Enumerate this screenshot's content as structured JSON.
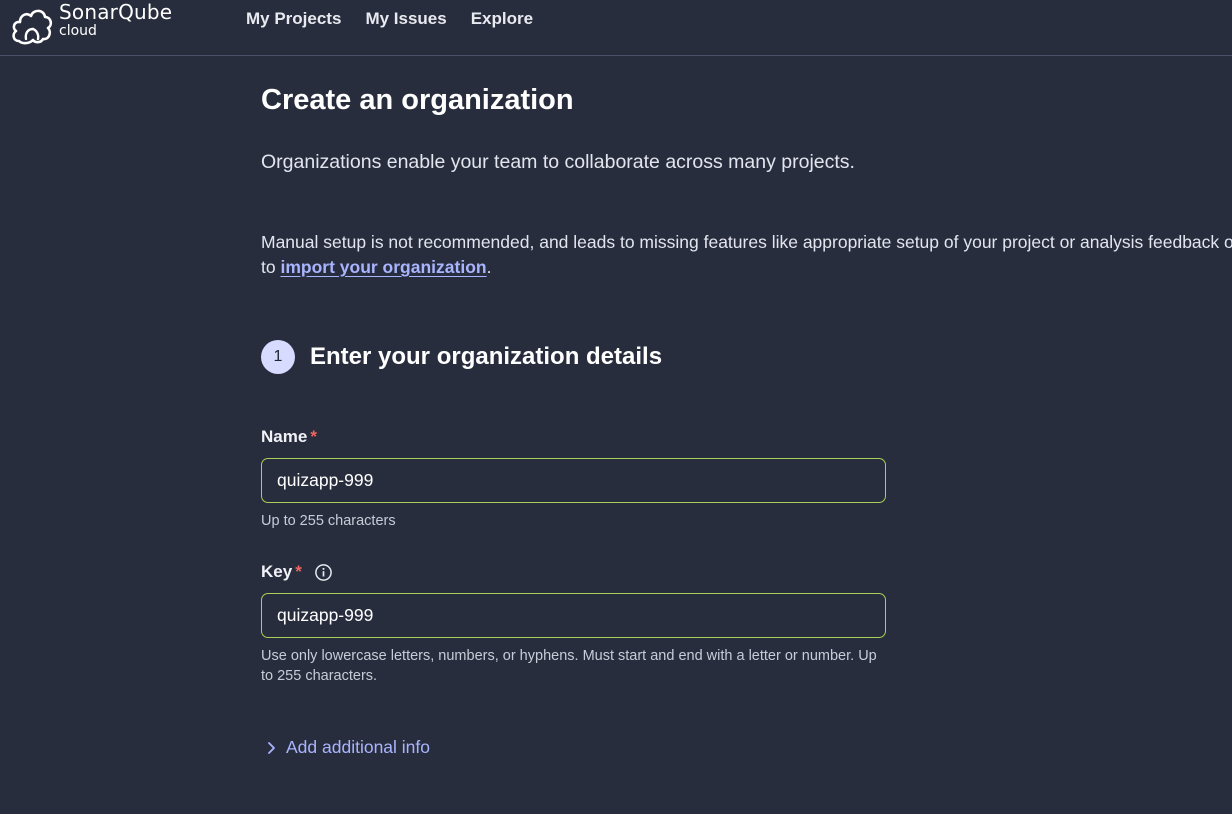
{
  "brand": {
    "name": "SonarQube",
    "sub": "cloud"
  },
  "nav": {
    "items": [
      {
        "label": "My Projects"
      },
      {
        "label": "My Issues"
      },
      {
        "label": "Explore"
      }
    ]
  },
  "page": {
    "title": "Create an organization",
    "subtitle": "Organizations enable your team to collaborate across many projects.",
    "warning_prefix": "Manual setup is not recommended, and leads to missing features like appropriate setup of your project or analysis feedback on the Pull Request. Click here",
    "warning_line2_prefix": "to ",
    "warning_link": "import your organization",
    "warning_suffix": "."
  },
  "step": {
    "number": "1",
    "title": "Enter your organization details"
  },
  "form": {
    "name": {
      "label": "Name",
      "required_mark": "*",
      "value": "quizapp-999",
      "help": "Up to 255 characters"
    },
    "key": {
      "label": "Key",
      "required_mark": "*",
      "value": "quizapp-999",
      "help": "Use only lowercase letters, numbers, or hyphens. Must start and end with a letter or number. Up to 255 characters."
    },
    "add_info_label": "Add additional info"
  },
  "colors": {
    "background": "#282d3d",
    "link": "#a9b4ff",
    "input_border": "#a7cf5a",
    "required": "#f2655f",
    "step_badge": "#d7dbff"
  },
  "icons": {
    "logo": "sonarqube-cloud-logo-icon",
    "info": "info-icon",
    "chevron": "chevron-right-icon"
  }
}
